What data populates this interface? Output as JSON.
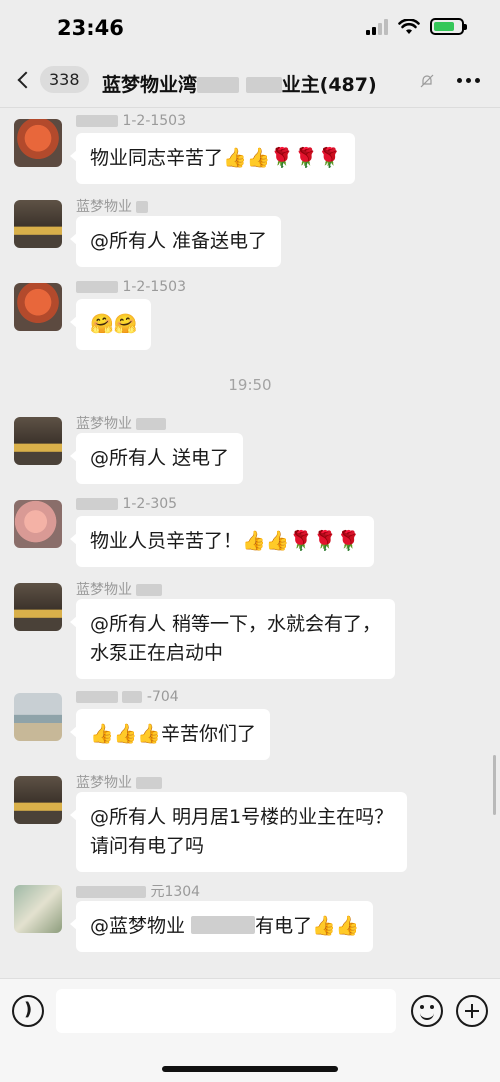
{
  "status_bar": {
    "time": "23:46",
    "battery_level": 0.75,
    "battery_color": "#35c759"
  },
  "nav": {
    "back_count": "338",
    "title_start": "蓝梦物业湾",
    "title_mid": "业主",
    "title_count": "(487)",
    "mute_icon": "bell-slash-icon",
    "more_icon": "ellipsis-icon"
  },
  "messages": [
    {
      "sender": "1-2-1503",
      "text": "物业同志辛苦了👍👍🌹🌹🌹",
      "avatar": "flower"
    },
    {
      "sender": "蓝梦物业",
      "text": "@所有人 准备送电了",
      "avatar": "property"
    },
    {
      "sender": "1-2-1503",
      "text": "🤗🤗",
      "avatar": "flower"
    },
    {
      "sender": "蓝梦物业",
      "text": "@所有人 送电了",
      "avatar": "property"
    },
    {
      "sender": "1-2-305",
      "text": "物业人员辛苦了！👍👍🌹🌹🌹",
      "avatar": "flower2"
    },
    {
      "sender": "蓝梦物业",
      "text": "@所有人 稍等一下，水就会有了，\n水泵正在启动中",
      "avatar": "property"
    },
    {
      "sender": "-704",
      "text": "👍👍👍辛苦你们了",
      "avatar": "sea"
    },
    {
      "sender": "蓝梦物业",
      "text": "@所有人 明月居1号楼的业主在吗？\n请问有电了吗",
      "avatar": "property"
    },
    {
      "sender": "元1304",
      "text_start": "@蓝梦物业",
      "text_end": "有电了👍👍",
      "avatar": "art"
    }
  ],
  "time_divider": "19:50",
  "input_bar": {
    "voice_icon": "voice-icon",
    "emoji_icon": "emoji-icon",
    "plus_icon": "plus-circle-icon",
    "input_value": ""
  }
}
